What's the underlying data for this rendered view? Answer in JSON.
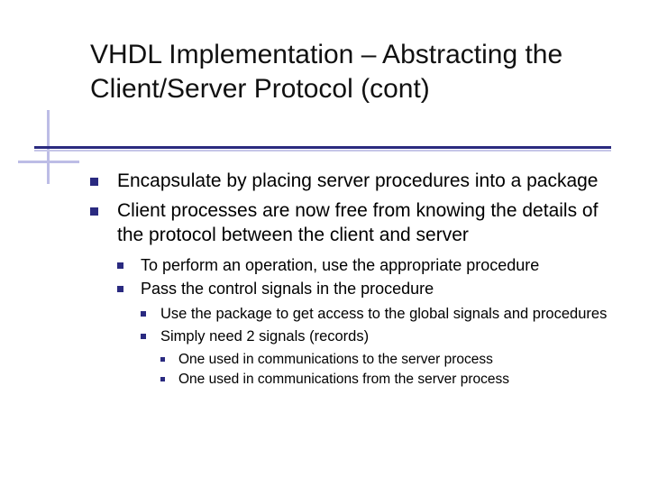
{
  "title": "VHDL Implementation – Abstracting the Client/Server Protocol (cont)",
  "bullets": [
    {
      "text": "Encapsulate by placing server procedures into a package"
    },
    {
      "text": "Client processes are now free from knowing the details of the protocol between the client and server",
      "children": [
        {
          "text": "To perform an operation, use the appropriate procedure"
        },
        {
          "text": "Pass the control signals in the procedure",
          "children": [
            {
              "text": "Use the package to get access to the global signals and procedures"
            },
            {
              "text": "Simply need 2 signals (records)",
              "children": [
                {
                  "text": "One used in communications to the server process"
                },
                {
                  "text": "One used in communications from the server process"
                }
              ]
            }
          ]
        }
      ]
    }
  ]
}
